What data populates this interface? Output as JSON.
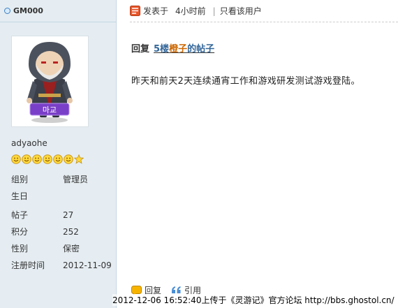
{
  "user": {
    "username": "GM000",
    "nickname": "adyaohe",
    "avatar_badge": "마교",
    "medal_count": 7,
    "info": [
      {
        "label": "组别",
        "value": "管理员"
      },
      {
        "label": "生日",
        "value": ""
      },
      {
        "label": "帖子",
        "value": "27"
      },
      {
        "label": "积分",
        "value": "252"
      },
      {
        "label": "性别",
        "value": "保密"
      },
      {
        "label": "注册时间",
        "value": "2012-11-09"
      }
    ]
  },
  "post": {
    "posted_label": "发表于",
    "time": "4小时前",
    "separator": "|",
    "only_author": "只看该用户",
    "reply_prefix": "回复",
    "reply_link_part1": "5楼",
    "reply_link_part2": "橙子",
    "reply_link_part3": "的帖子",
    "body": "昨天和前天2天连续通宵工作和游戏研发测试游戏登陆。",
    "reply_button": "回复",
    "quote_button": "引用"
  },
  "watermark": "2012-12-06 16:52:40上传于《灵游记》官方论坛 http://bbs.ghostol.cn/",
  "colors": {
    "sidebar_bg": "#e5edf2",
    "border": "#c2d5e3",
    "link_blue": "#336699",
    "link_orange": "#cc6600",
    "badge_purple": "#7a3fc8"
  }
}
